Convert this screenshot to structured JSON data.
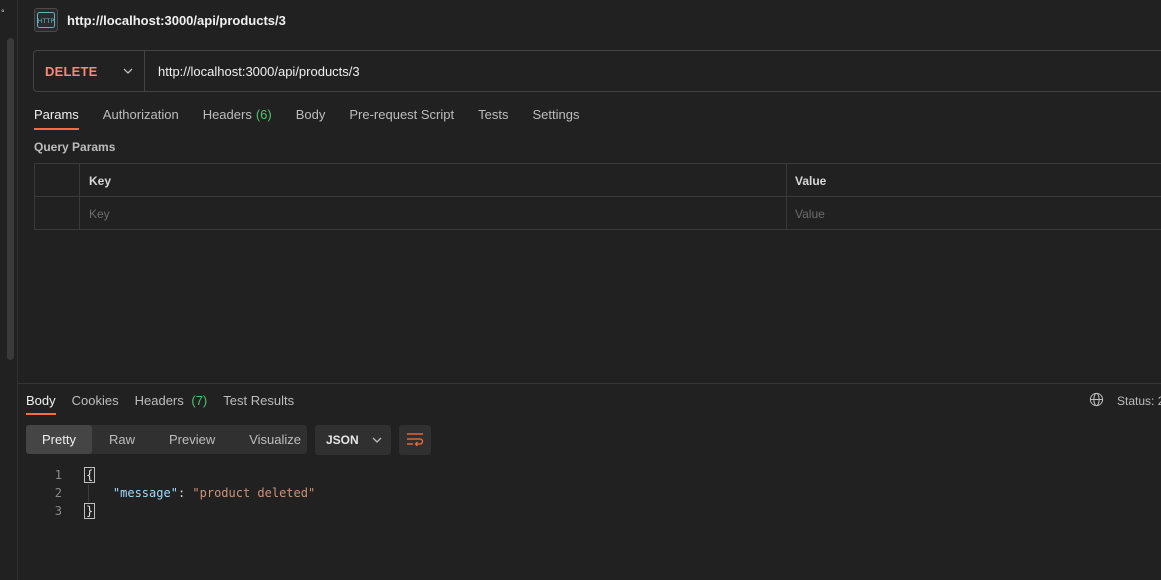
{
  "request": {
    "title": "http://localhost:3000/api/products/3",
    "method": "DELETE",
    "url": "http://localhost:3000/api/products/3",
    "tabs": [
      {
        "label": "Params"
      },
      {
        "label": "Authorization"
      },
      {
        "label": "Headers",
        "count": "(6)"
      },
      {
        "label": "Body"
      },
      {
        "label": "Pre-request Script"
      },
      {
        "label": "Tests"
      },
      {
        "label": "Settings"
      }
    ],
    "active_tab": "Params"
  },
  "query_params": {
    "label": "Query Params",
    "headers": {
      "key": "Key",
      "value": "Value"
    },
    "placeholders": {
      "key": "Key",
      "value": "Value"
    }
  },
  "response": {
    "tabs": [
      {
        "label": "Body"
      },
      {
        "label": "Cookies"
      },
      {
        "label": "Headers",
        "count": "(7)"
      },
      {
        "label": "Test Results"
      }
    ],
    "status_label": "Status: 2",
    "view_modes": [
      "Pretty",
      "Raw",
      "Preview",
      "Visualize"
    ],
    "active_view": "Pretty",
    "format": "JSON",
    "code": {
      "line_numbers": [
        "1",
        "2",
        "3"
      ],
      "open_brace": "{",
      "close_brace": "}",
      "key": "\"message\"",
      "colon": ": ",
      "value": "\"product deleted\""
    }
  },
  "colors": {
    "method": "#f58a7a",
    "accent": "#ff6c37",
    "count": "#4fc36f",
    "json_key": "#9cdcfe",
    "json_string": "#ce9178"
  },
  "icons": {
    "request_type": "http-icon",
    "status": "globe-icon",
    "wrap": "wrap-lines-icon"
  }
}
